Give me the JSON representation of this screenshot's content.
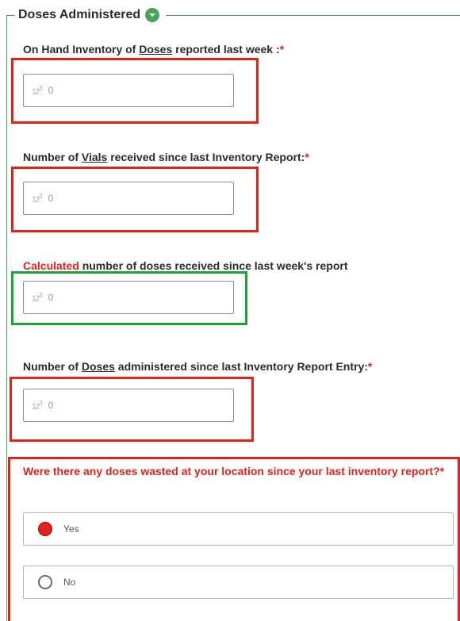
{
  "group": {
    "title": "Doses Administered"
  },
  "questions": {
    "on_hand": {
      "prefix": "On Hand Inventory of ",
      "underlined": "Doses",
      "suffix": " reported last week :",
      "required_mark": "*",
      "value": "0"
    },
    "vials": {
      "prefix": "Number of ",
      "underlined": "Vials",
      "suffix": " received since last Inventory Report:",
      "required_mark": "*",
      "value": "0"
    },
    "calculated": {
      "red_prefix": "Calculated",
      "suffix": " number of doses received since last week's report",
      "value": "0"
    },
    "administered": {
      "prefix": "Number of ",
      "underlined": "Doses",
      "suffix": " administered since last Inventory Report Entry:",
      "required_mark": "*",
      "value": "0"
    },
    "wasted": {
      "text": "Were there any doses wasted at your location since your last inventory report?*",
      "options": [
        {
          "label": "Yes",
          "selected": true
        },
        {
          "label": "No",
          "selected": false
        }
      ]
    }
  },
  "number_icon": {
    "text": "12",
    "sup": "3"
  },
  "colors": {
    "accent_green": "#4aa35a",
    "required_red": "#e0231c",
    "highlight_red": "#e0231c",
    "highlight_green": "#1fa23a"
  },
  "icons": {
    "collapse": "chevron-down-icon",
    "number_field": "number-123-icon"
  }
}
